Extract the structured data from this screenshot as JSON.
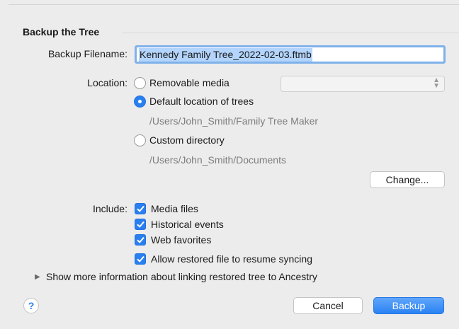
{
  "section": {
    "title": "Backup the Tree"
  },
  "filename": {
    "label": "Backup Filename:",
    "value": "Kennedy Family Tree_2022-02-03.ftmb"
  },
  "location": {
    "label": "Location:",
    "options": [
      {
        "label": "Removable media",
        "selected": false
      },
      {
        "label": "Default location of trees",
        "selected": true,
        "path": "/Users/John_Smith/Family Tree Maker"
      },
      {
        "label": "Custom directory",
        "selected": false,
        "path": "/Users/John_Smith/Documents"
      }
    ],
    "change_button": "Change..."
  },
  "include": {
    "label": "Include:",
    "items": [
      {
        "label": "Media files",
        "checked": true
      },
      {
        "label": "Historical events",
        "checked": true
      },
      {
        "label": "Web favorites",
        "checked": true
      },
      {
        "label": "Allow restored file to resume syncing",
        "checked": true
      }
    ]
  },
  "disclosure": {
    "label": "Show more information about linking restored tree to Ancestry"
  },
  "footer": {
    "help": "?",
    "cancel": "Cancel",
    "backup": "Backup"
  },
  "colors": {
    "accent": "#2a7ff0",
    "path_gray": "#7d7d7d"
  },
  "icons": {
    "disclosure": "triangle-right-icon",
    "popup": "up-down-chevron-icon",
    "check": "checkmark-icon"
  }
}
